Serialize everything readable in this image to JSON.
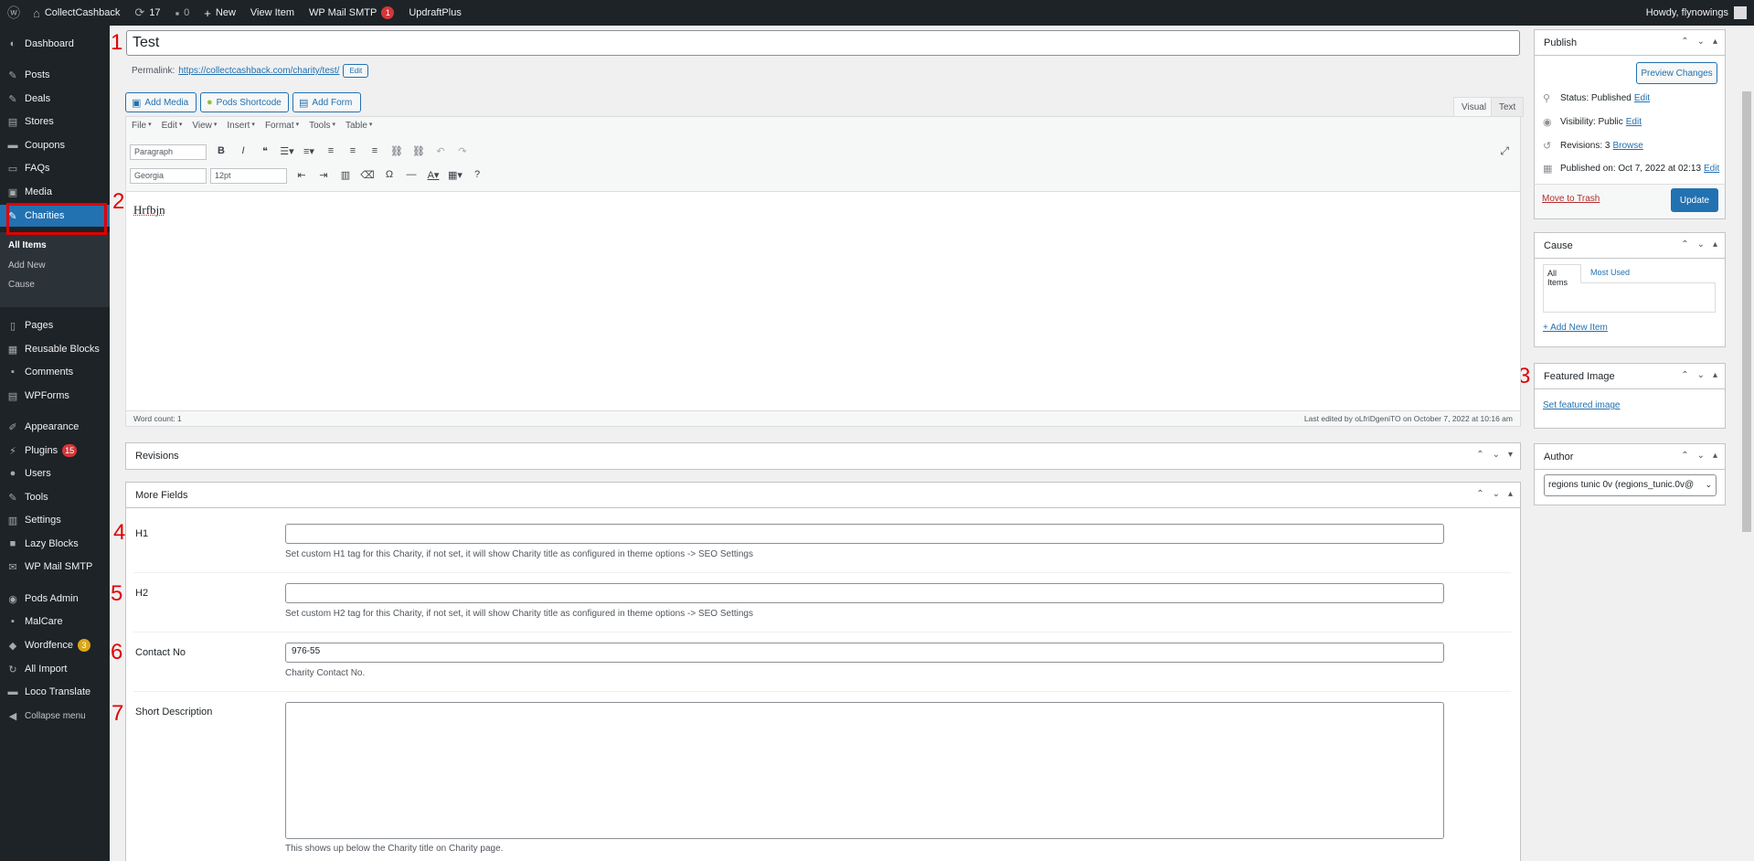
{
  "adminbar": {
    "site": "CollectCashback",
    "updates": "17",
    "comments": "0",
    "new": "New",
    "view_item": "View Item",
    "wpmail": "WP Mail SMTP",
    "wpmail_badge": "1",
    "updraft": "UpdraftPlus",
    "howdy": "Howdy, flynowings"
  },
  "sidebar": {
    "items": [
      {
        "label": "Dashboard"
      },
      {
        "label": "Posts"
      },
      {
        "label": "Deals"
      },
      {
        "label": "Stores"
      },
      {
        "label": "Coupons"
      },
      {
        "label": "FAQs"
      },
      {
        "label": "Media"
      },
      {
        "label": "Charities"
      },
      {
        "label": "Pages"
      },
      {
        "label": "Reusable Blocks"
      },
      {
        "label": "Comments"
      },
      {
        "label": "WPForms"
      },
      {
        "label": "Appearance"
      },
      {
        "label": "Plugins",
        "badge": "15"
      },
      {
        "label": "Users"
      },
      {
        "label": "Tools"
      },
      {
        "label": "Settings"
      },
      {
        "label": "Lazy Blocks"
      },
      {
        "label": "WP Mail SMTP"
      },
      {
        "label": "Pods Admin"
      },
      {
        "label": "MalCare"
      },
      {
        "label": "Wordfence",
        "badge": "3"
      },
      {
        "label": "All Import"
      },
      {
        "label": "Loco Translate"
      },
      {
        "label": "Collapse menu"
      }
    ],
    "submenu": [
      "All Items",
      "Add New",
      "Cause"
    ]
  },
  "annotations": [
    "1",
    "2",
    "3",
    "4",
    "5",
    "6",
    "7"
  ],
  "editor": {
    "title": "Test",
    "permalink_label": "Permalink:",
    "permalink_url": "https://collectcashback.com/charity/test/",
    "permalink_edit": "Edit",
    "add_media": "Add Media",
    "pods_shortcode": "Pods Shortcode",
    "add_form": "Add Form",
    "tab_visual": "Visual",
    "tab_text": "Text",
    "menus": [
      "File",
      "Edit",
      "View",
      "Insert",
      "Format",
      "Tools",
      "Table"
    ],
    "format_select": "Paragraph",
    "font_select": "Georgia",
    "size_select": "12pt",
    "content": "Hrfbjn",
    "word_count": "Word count: 1",
    "last_edited": "Last edited by oLfriDgeniTO on October 7, 2022 at 10:16 am"
  },
  "revisions_box": {
    "title": "Revisions"
  },
  "more_fields": {
    "title": "More Fields",
    "fields": [
      {
        "label": "H1",
        "value": "",
        "desc": "Set custom H1 tag for this Charity, if not set, it will show Charity title as configured in theme options -> SEO Settings"
      },
      {
        "label": "H2",
        "value": "",
        "desc": "Set custom H2 tag for this Charity, if not set, it will show Charity title as configured in theme options -> SEO Settings"
      },
      {
        "label": "Contact No",
        "value": "976-55",
        "desc": "Charity Contact No."
      },
      {
        "label": "Short Description",
        "value": "",
        "desc": "This shows up below the Charity title on Charity page."
      }
    ]
  },
  "publish": {
    "title": "Publish",
    "preview": "Preview Changes",
    "status_label": "Status:",
    "status_value": "Published",
    "visibility_label": "Visibility:",
    "visibility_value": "Public",
    "revisions_label": "Revisions:",
    "revisions_value": "3",
    "browse": "Browse",
    "published_on_label": "Published on:",
    "published_on_value": "Oct 7, 2022 at 02:13",
    "edit": "Edit",
    "trash": "Move to Trash",
    "update": "Update"
  },
  "cause": {
    "title": "Cause",
    "tab_all": "All Items",
    "tab_most": "Most Used",
    "add_new": "+ Add New Item"
  },
  "featured": {
    "title": "Featured Image",
    "set": "Set featured image"
  },
  "author": {
    "title": "Author",
    "value": "regions tunic 0v (regions_tunic.0v@"
  }
}
